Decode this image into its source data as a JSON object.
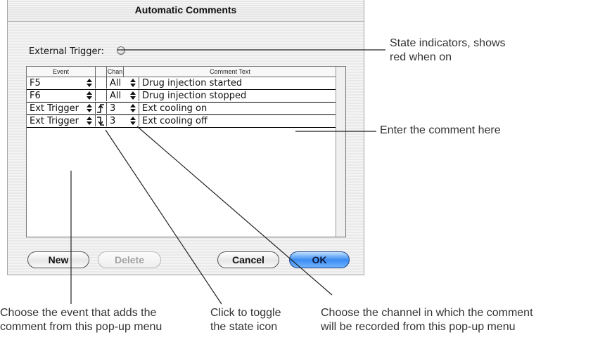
{
  "dialog": {
    "title": "Automatic Comments",
    "external_trigger_label": "External Trigger:",
    "table": {
      "headers": [
        "Event",
        "",
        "Chan",
        "Comment Text"
      ],
      "rows": [
        {
          "event": "F5",
          "state": "",
          "chan": "All",
          "comment": "Drug injection started"
        },
        {
          "event": "F6",
          "state": "",
          "chan": "All",
          "comment": "Drug injection stopped"
        },
        {
          "event": "Ext Trigger",
          "state": "rising",
          "chan": "3",
          "comment": "Ext cooling on"
        },
        {
          "event": "Ext Trigger",
          "state": "falling",
          "chan": "3",
          "comment": "Ext cooling off"
        }
      ]
    },
    "buttons": {
      "new": "New",
      "delete": "Delete",
      "cancel": "Cancel",
      "ok": "OK"
    }
  },
  "callouts": {
    "state_indicators_line1": "State indicators, shows",
    "state_indicators_line2": "red when on",
    "enter_comment": "Enter the comment here",
    "event_line1": "Choose the event that adds the",
    "event_line2": "comment from this pop-up menu",
    "toggle_line1": "Click to toggle",
    "toggle_line2": "the state icon",
    "channel_line1": "Choose the channel in which the comment",
    "channel_line2": "will be recorded from this pop-up menu"
  },
  "colors": {
    "ok_button": "#3c8cf2",
    "indicator_off": "#dadada"
  }
}
